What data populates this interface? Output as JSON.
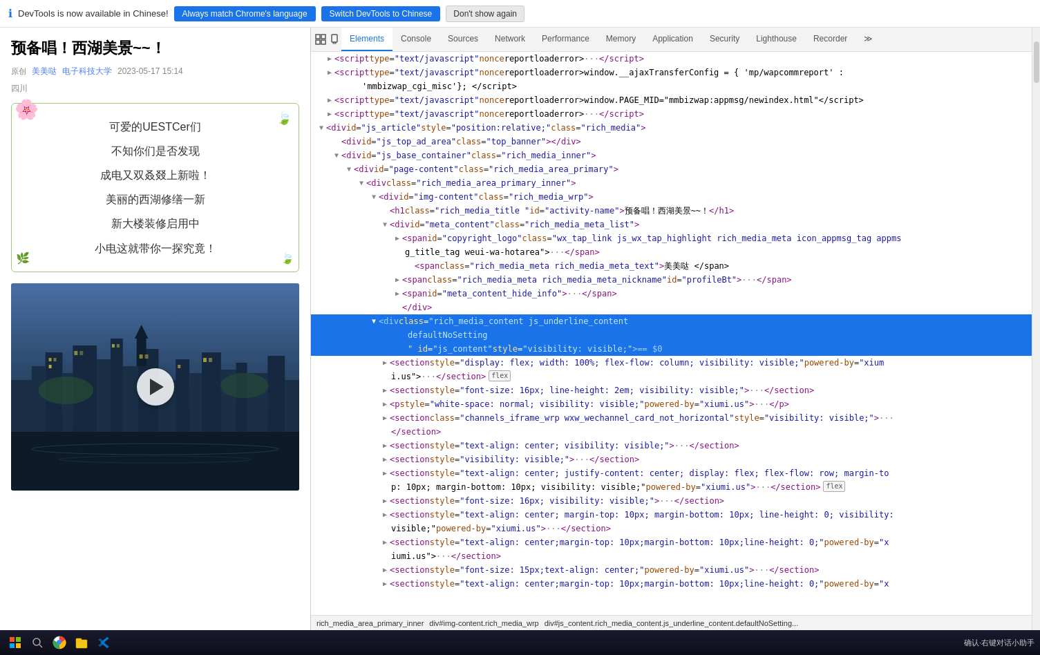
{
  "notification": {
    "info_icon": "ℹ",
    "message": "DevTools is now available in Chinese!",
    "btn_always": "Always match Chrome's language",
    "btn_switch": "Switch DevTools to Chinese",
    "btn_dont": "Don't show again"
  },
  "left_panel": {
    "article_title": "预备唱！西湖美景~~！",
    "meta": {
      "original_label": "原创",
      "author": "美美哒",
      "affil": "电子科技大学",
      "date": "2023-05-17 15:14"
    },
    "location": "四川",
    "poem_lines": [
      "可爱的UESTCer们",
      "不知你们是否发现",
      "成电又双叒叕上新啦！",
      "美丽的西湖修缮一新",
      "新大楼装修启用中",
      "小电这就带你一探究竟！"
    ]
  },
  "devtools": {
    "tabs": [
      "Elements",
      "Console",
      "Sources",
      "Network",
      "Performance",
      "Memory",
      "Application",
      "Security",
      "Lighthouse",
      "Recorder",
      "≫"
    ],
    "active_tab": "Elements"
  },
  "breadcrumb": {
    "items": [
      "rich_media_area_primary_inner",
      "div#img-content.rich_media_wrp",
      "div#js_content.rich_media_content.js_underline_content.defaultNoSetting..."
    ]
  },
  "taskbar": {
    "right_text": "确认·右键对话小助手"
  }
}
